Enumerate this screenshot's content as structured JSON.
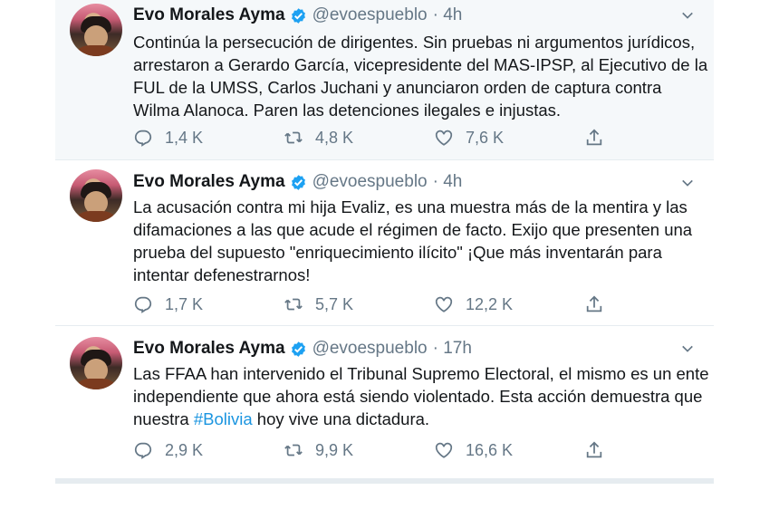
{
  "tweets": [
    {
      "name": "Evo Morales Ayma",
      "handle": "@evoespueblo",
      "time": "· 4h",
      "lines": [
        "Continúa la persecución de dirigentes. Sin pruebas ni argumentos jurídicos,",
        "arrestaron a Gerardo García, vicepresidente del MAS-IPSP, al Ejecutivo de la",
        "FUL de la UMSS, Carlos Juchani  y anunciaron orden de captura contra",
        "Wilma Alanoca. Paren las detenciones ilegales e injustas."
      ],
      "replies": "1,4 K",
      "retweets": "4,8 K",
      "likes": "7,6 K"
    },
    {
      "name": "Evo Morales Ayma",
      "handle": "@evoespueblo",
      "time": "· 4h",
      "lines": [
        "La acusación contra mi hija Evaliz, es una muestra más de la mentira y las",
        "difamaciones a las que acude el régimen de facto. Exijo que presenten una",
        "prueba del supuesto \"enriquecimiento ilícito\" ¡Que más inventarán para",
        "intentar defenestrarnos!"
      ],
      "replies": "1,7 K",
      "retweets": "5,7 K",
      "likes": "12,2 K"
    },
    {
      "name": "Evo Morales Ayma",
      "handle": "@evoespueblo",
      "time": "· 17h",
      "lines": [
        "Las FFAA han intervenido el Tribunal Supremo Electoral, el mismo es un ente",
        "independiente que ahora está siendo violentado. Esta acción demuestra que"
      ],
      "line3_before": "nuestra ",
      "hashtag": "#Bolivia",
      "line3_after": " hoy vive una dictadura.",
      "replies": "2,9 K",
      "retweets": "9,9 K",
      "likes": "16,6 K"
    }
  ],
  "colors": {
    "text": "#14171a",
    "secondary": "#657786",
    "link": "#1b95e0",
    "verified": "#1da1f2",
    "highlight_bg": "#f5f8fa",
    "divider": "#e6ecf0"
  },
  "icons": [
    "verified-badge-icon",
    "chevron-down-icon",
    "reply-icon",
    "retweet-icon",
    "like-icon",
    "share-icon"
  ]
}
